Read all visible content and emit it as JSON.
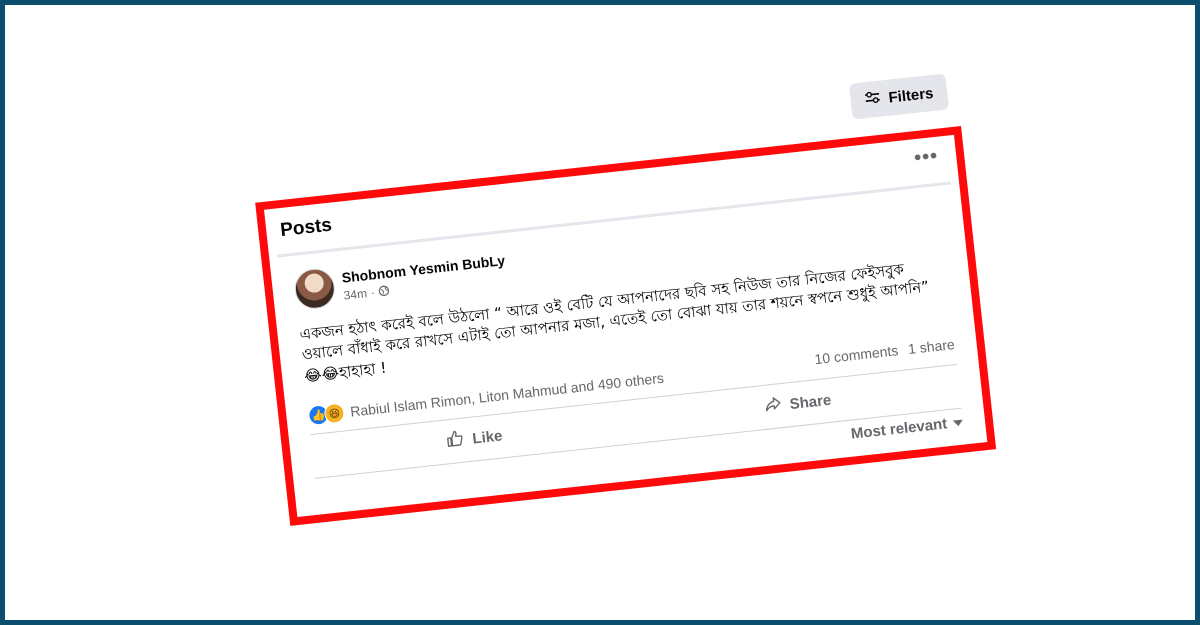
{
  "filters": {
    "label": "Filters"
  },
  "posts": {
    "title": "Posts",
    "more": "•••"
  },
  "post": {
    "author": "Shobnom Yesmin BubLy",
    "time": "34m",
    "meta_sep": "·",
    "text": "একজন হঠাৎ করেই বলে উঠলো “ আরে ওই বেটি যে আপনাদের ছবি সহ নিউজ তার নিজের ফেইসবুক ওয়ালে বাঁধাই করে রাখসে এটাই তো আপনার মজা, এতেই তো বোঝা যায় তার শয়নে স্বপনে শুধুই আপনি”",
    "reaction_text": "😂😂হাহাহা !"
  },
  "stats": {
    "reactors": "Rabiul Islam Rimon, Liton Mahmud and 490 others",
    "comments": "10 comments",
    "shares": "1 share"
  },
  "actions": {
    "like": "Like",
    "share": "Share"
  },
  "sort": {
    "label": "Most relevant"
  },
  "colors": {
    "highlight_border": "#ff0a0a",
    "frame_border": "#0b4f6c",
    "accent": "#1877f2"
  }
}
